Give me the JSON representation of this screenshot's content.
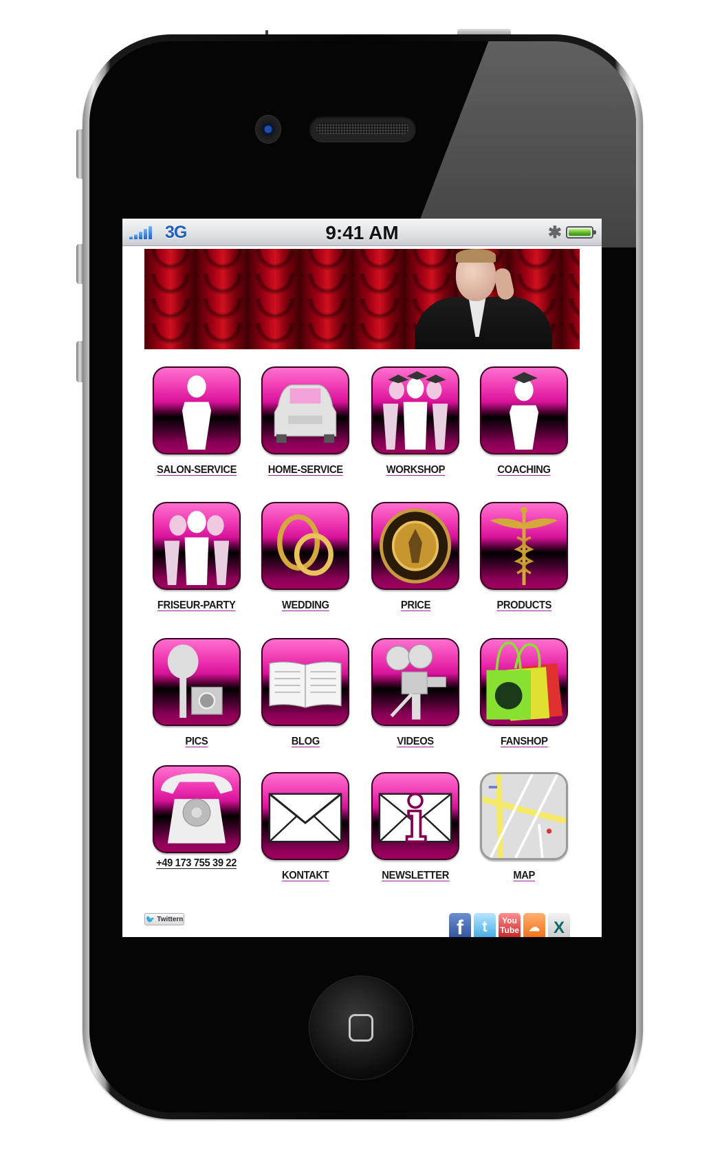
{
  "status_bar": {
    "network": "3G",
    "time": "9:41 AM",
    "bluetooth_icon": "bluetooth-icon",
    "battery_level": 1.0
  },
  "banner": {
    "description": "Red theatre curtain with man in black suit holding scissors"
  },
  "tiles": [
    {
      "label": "SALON-SERVICE",
      "icon": "person-icon"
    },
    {
      "label": "HOME-SERVICE",
      "icon": "car-icon"
    },
    {
      "label": "WORKSHOP",
      "icon": "graduates-group-icon"
    },
    {
      "label": "COACHING",
      "icon": "graduate-person-icon"
    },
    {
      "label": "FRISEUR-PARTY",
      "icon": "group-icon"
    },
    {
      "label": "WEDDING",
      "icon": "wedding-rings-icon"
    },
    {
      "label": "PRICE",
      "icon": "gold-coin-icon"
    },
    {
      "label": "PRODUCTS",
      "icon": "caduceus-icon"
    },
    {
      "label": "PICS",
      "icon": "camera-icon"
    },
    {
      "label": "BLOG",
      "icon": "open-book-icon"
    },
    {
      "label": "VIDEOS",
      "icon": "film-camera-icon"
    },
    {
      "label": "FANSHOP",
      "icon": "shopping-bags-icon"
    },
    {
      "label": "+49 173 755 39 22",
      "icon": "telephone-icon"
    },
    {
      "label": "KONTAKT",
      "icon": "envelope-icon"
    },
    {
      "label": "NEWSLETTER",
      "icon": "newsletter-info-icon"
    },
    {
      "label": "MAP",
      "icon": "map-icon"
    }
  ],
  "footer": {
    "tweet_button": "Twittern",
    "socials": [
      {
        "name": "facebook",
        "glyph": "f"
      },
      {
        "name": "twitter",
        "glyph": "t"
      },
      {
        "name": "youtube",
        "glyph": "You Tube"
      },
      {
        "name": "soundcloud",
        "glyph": "☁"
      },
      {
        "name": "xing",
        "glyph": "X"
      }
    ]
  },
  "colors": {
    "tile_pink": "#f03bb4",
    "tile_dark": "#a0005f",
    "link_underline": "#a0209a",
    "status_network_blue": "#1f5fbf"
  }
}
